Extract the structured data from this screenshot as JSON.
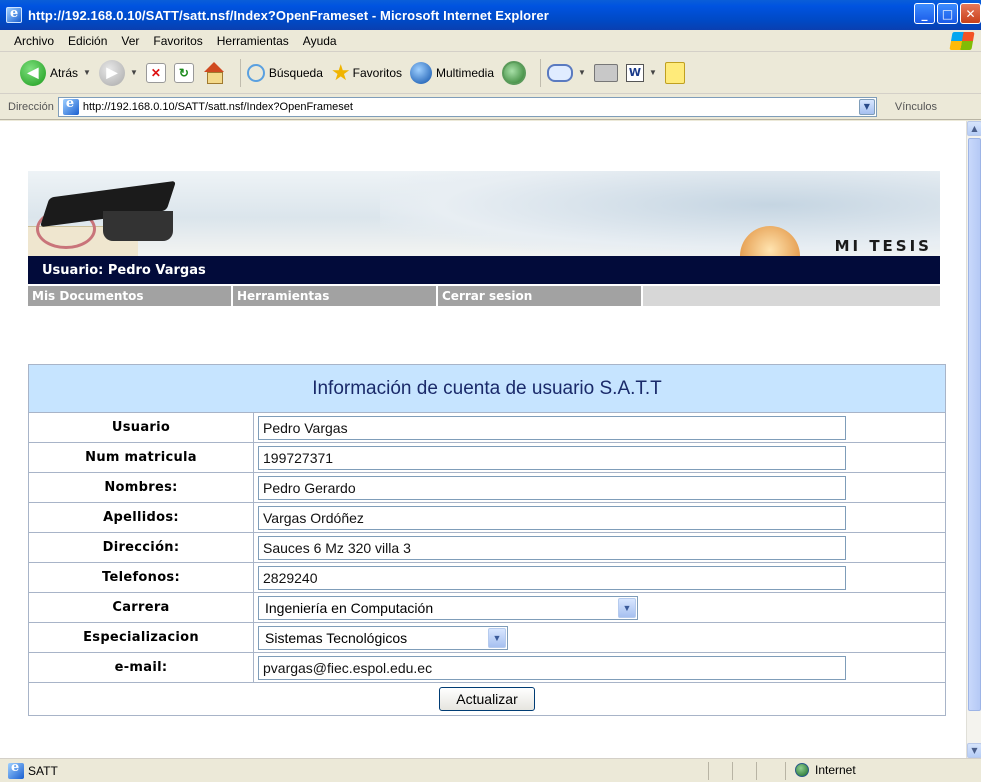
{
  "window": {
    "title": "http://192.168.0.10/SATT/satt.nsf/Index?OpenFrameset - Microsoft Internet Explorer",
    "controls": {
      "minimize": "_",
      "maximize": "□",
      "close": "✕"
    }
  },
  "menubar": [
    "Archivo",
    "Edición",
    "Ver",
    "Favoritos",
    "Herramientas",
    "Ayuda"
  ],
  "toolbar": {
    "back_label": "Atrás",
    "search_label": "Búsqueda",
    "favorites_label": "Favoritos",
    "media_label": "Multimedia"
  },
  "address": {
    "label": "Dirección",
    "url": "http://192.168.0.10/SATT/satt.nsf/Index?OpenFrameset",
    "links_label": "Vínculos"
  },
  "banner": {
    "brand": "MI TESIS",
    "user_line": "Usuario: Pedro Vargas"
  },
  "nav": [
    "Mis Documentos",
    "Herramientas",
    "Cerrar sesion"
  ],
  "form": {
    "title": "Información de cuenta de usuario S.A.T.T",
    "fields": [
      {
        "label": "Usuario",
        "value": "Pedro Vargas"
      },
      {
        "label": "Num matricula",
        "value": "199727371"
      },
      {
        "label": "Nombres:",
        "value": "Pedro Gerardo"
      },
      {
        "label": "Apellidos:",
        "value": "Vargas Ordóñez"
      },
      {
        "label": "Dirección:",
        "value": "Sauces 6 Mz 320 villa 3"
      },
      {
        "label": "Telefonos:",
        "value": "2829240"
      }
    ],
    "selects": [
      {
        "label": "Carrera",
        "value": "Ingeniería en Computación"
      },
      {
        "label": "Especializacion",
        "value": "Sistemas Tecnológicos"
      }
    ],
    "email": {
      "label": "e-mail:",
      "value": "pvargas@fiec.espol.edu.ec"
    },
    "submit_label": "Actualizar"
  },
  "statusbar": {
    "text": "SATT",
    "zone": "Internet"
  }
}
